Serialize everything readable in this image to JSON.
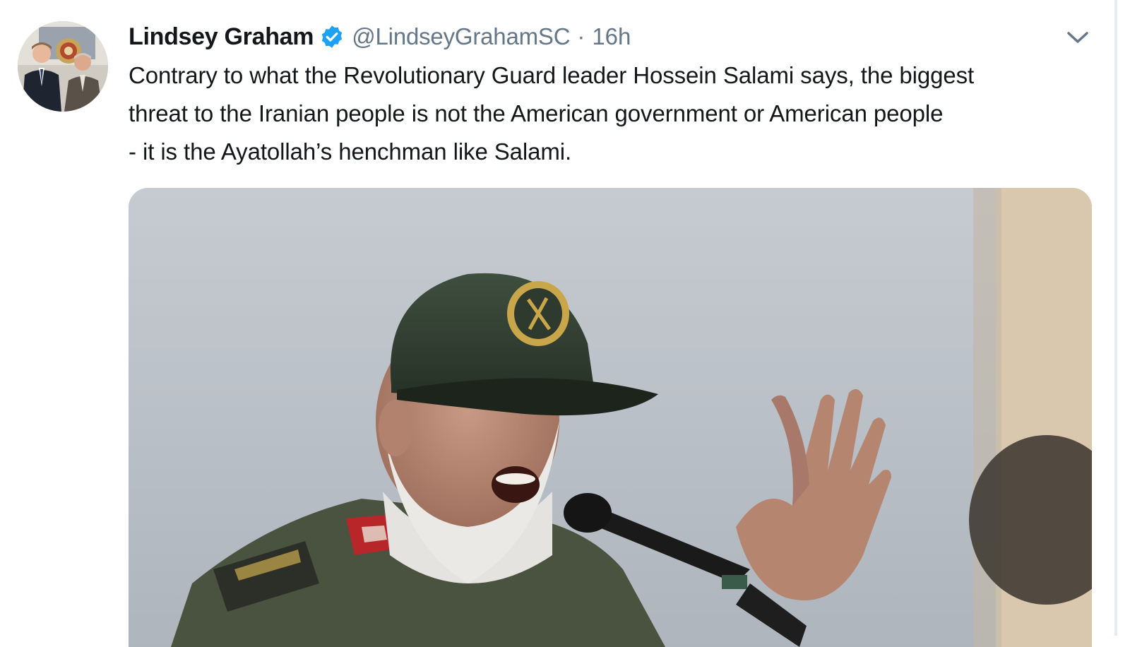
{
  "tweet": {
    "author_name": "Lindsey Graham",
    "verified": true,
    "handle": "@LindseyGrahamSC",
    "separator": "·",
    "time": "16h",
    "text_lines": [
      "Contrary to what the Revolutionary Guard leader Hossein Salami says, the biggest",
      "threat to the Iranian people is not the American government or American people",
      "- it is the Ayatollah’s henchman like Salami."
    ]
  },
  "icons": {
    "verified": "verified-badge-icon",
    "menu": "chevron-down-icon"
  },
  "colors": {
    "text": "#14171a",
    "secondary_text": "#657786",
    "verified_blue": "#1da1f2"
  }
}
